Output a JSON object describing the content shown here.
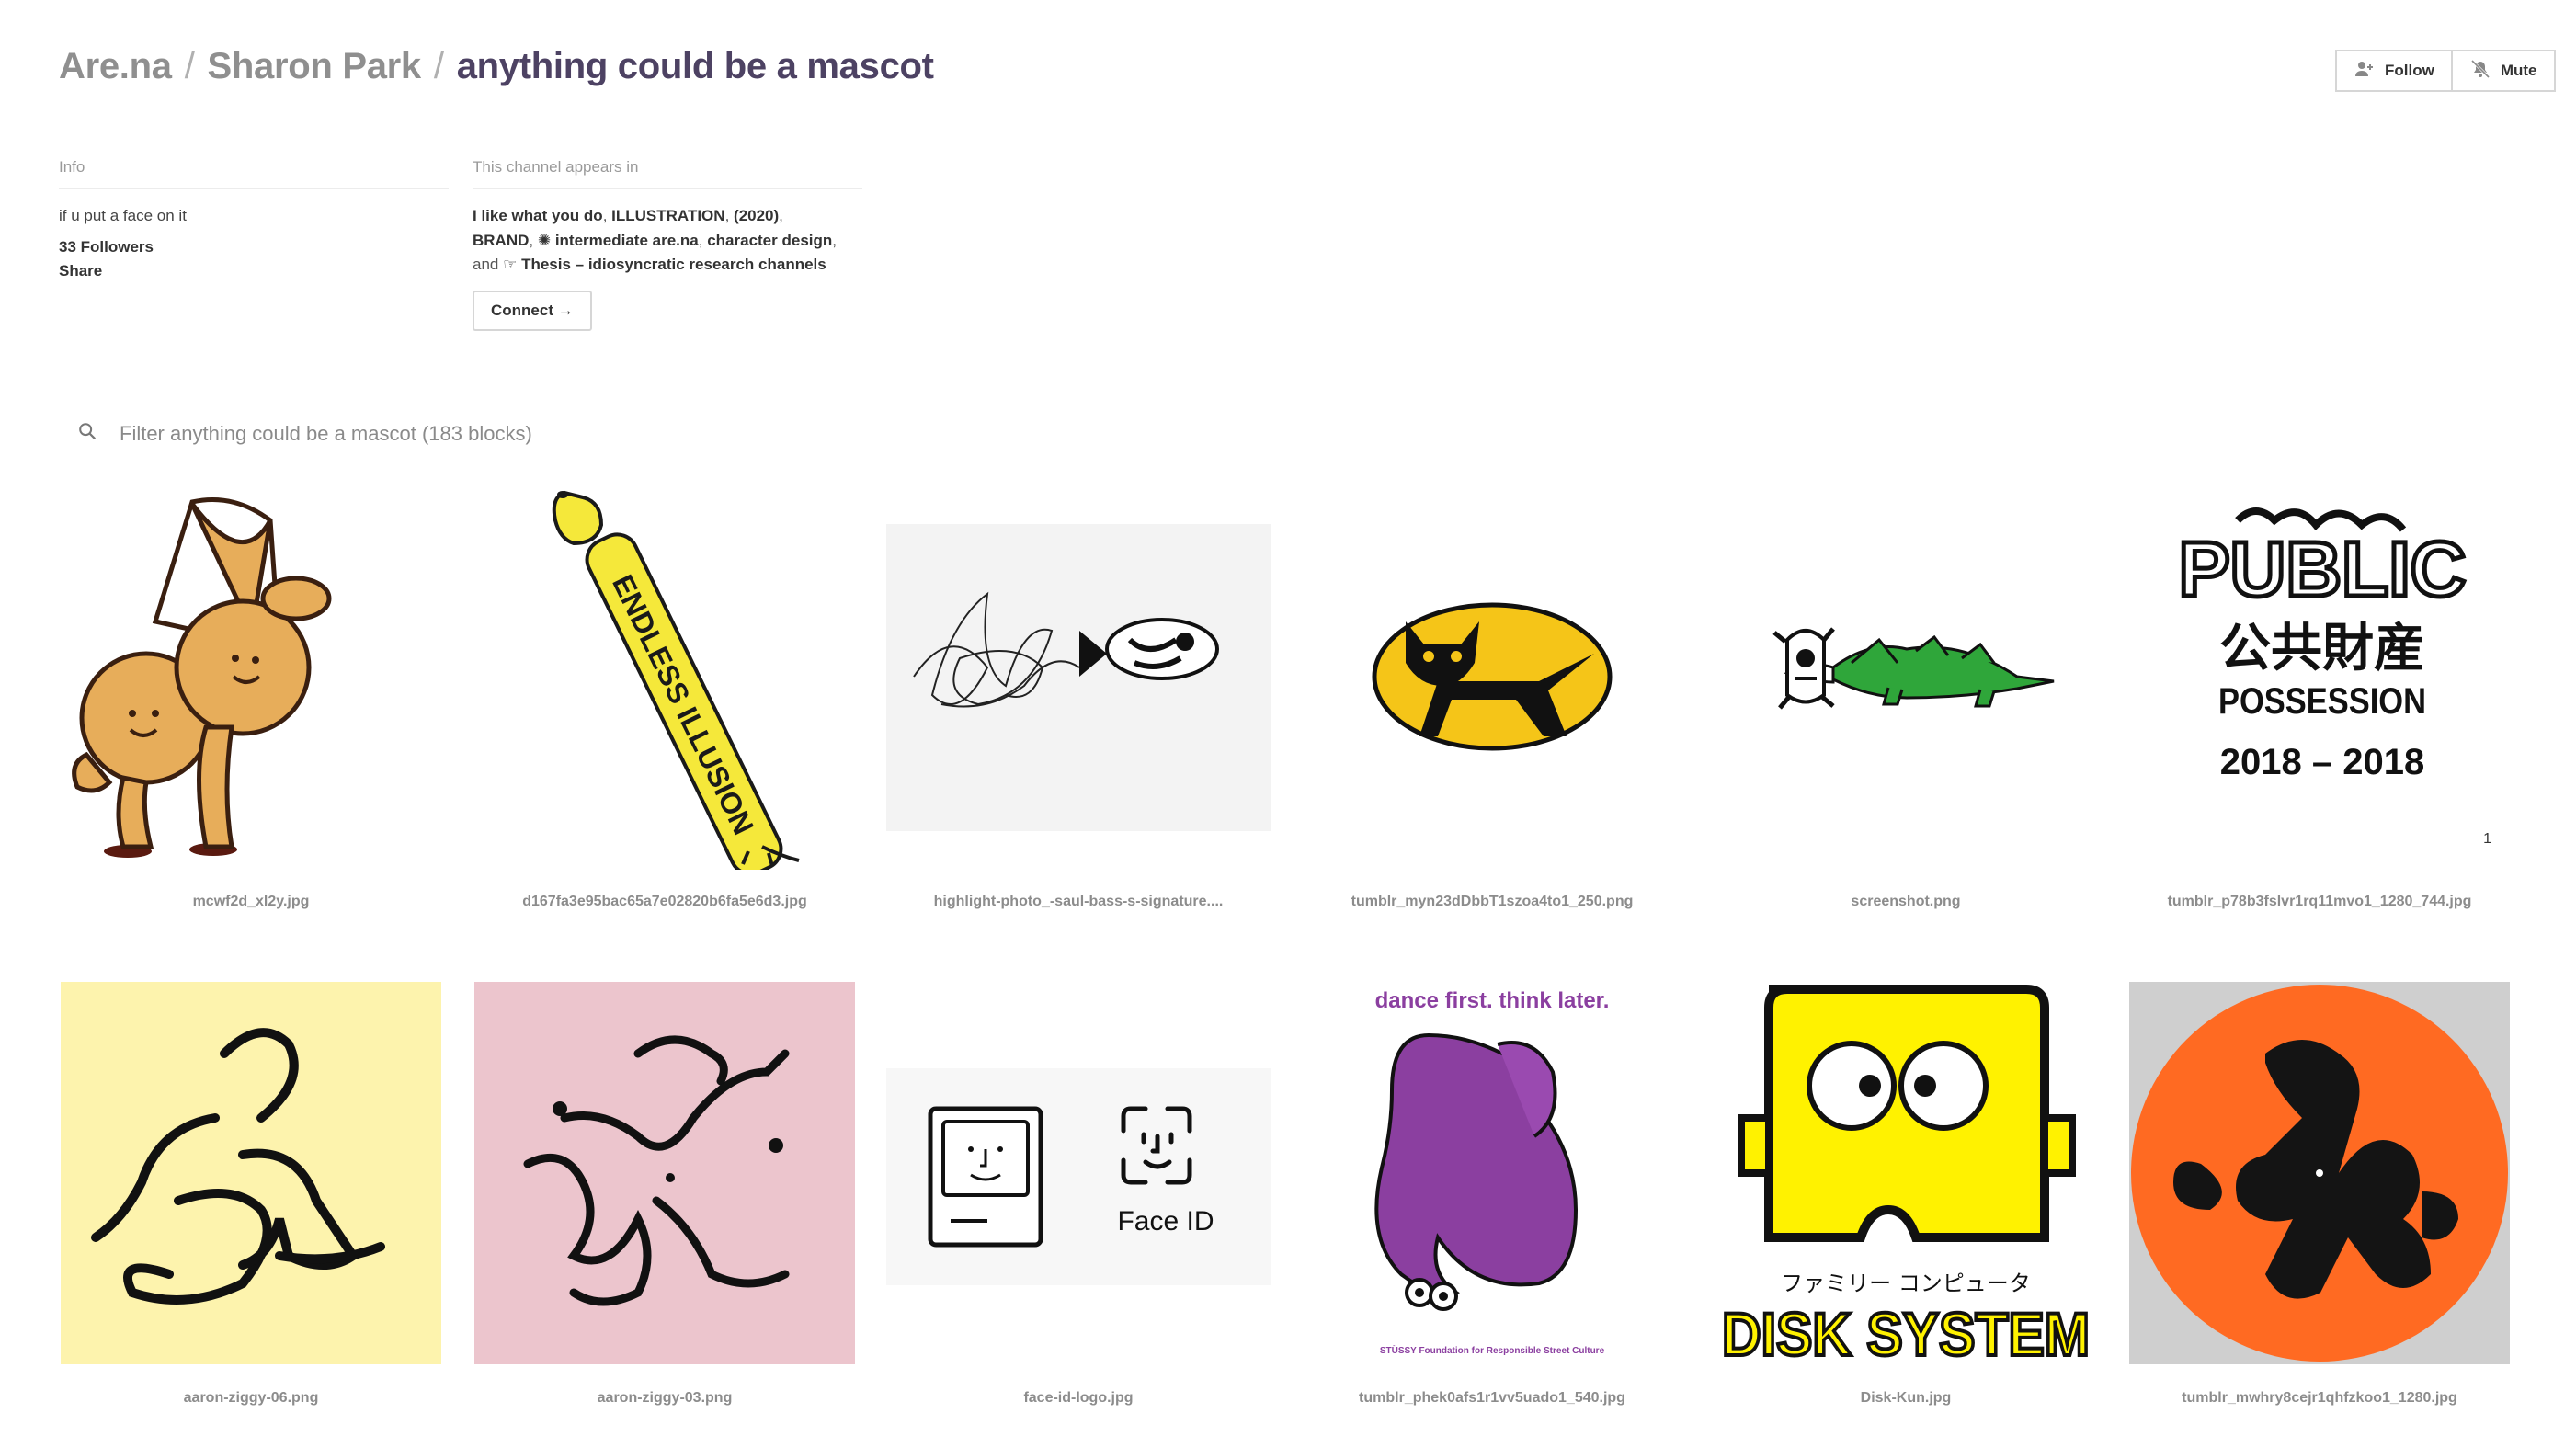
{
  "breadcrumb": {
    "root": "Are.na",
    "user": "Sharon Park",
    "channel": "anything could be a mascot",
    "separator": "/"
  },
  "actions": {
    "follow_label": "Follow",
    "mute_label": "Mute"
  },
  "info": {
    "heading": "Info",
    "description": "if u put a face on it",
    "followers": "33 Followers",
    "share": "Share"
  },
  "appears_in": {
    "heading": "This channel appears in",
    "channels": [
      "I like what you do",
      "ILLUSTRATION",
      "(2020)",
      "BRAND",
      "✺ intermediate are.na",
      "character design",
      "☞ Thesis – idiosyncratic research channels"
    ],
    "sep_comma": ",",
    "sep_and": "and",
    "connect_label": "Connect →"
  },
  "search": {
    "placeholder": "Filter anything could be a mascot (183 blocks)"
  },
  "blocks": [
    {
      "caption": "mcwf2d_xl2y.jpg",
      "icon": "music-note-mascot"
    },
    {
      "caption": "d167fa3e95bac65a7e02820b6fa5e6d3.jpg",
      "icon": "endless-illusion-dachshund",
      "text": "ENDLESS ILLUSION"
    },
    {
      "caption": "highlight-photo_-saul-bass-s-signature....",
      "icon": "signature-fish"
    },
    {
      "caption": "tumblr_myn23dDbbT1szoa4to1_250.png",
      "icon": "yamato-cat-logo"
    },
    {
      "caption": "screenshot.png",
      "icon": "crocodile-eating-person"
    },
    {
      "caption": "tumblr_p78b3fslvr1rq11mvo1_1280_744.jpg",
      "icon": "public-possession-logo",
      "lines": [
        "PUBLIC",
        "公共財産",
        "POSSESSION",
        "2018 – 2018"
      ],
      "count": "1"
    },
    {
      "caption": "aaron-ziggy-06.png",
      "icon": "ziggy-figure-yellow",
      "bg": "#fdf3ad"
    },
    {
      "caption": "aaron-ziggy-03.png",
      "icon": "ziggy-figure-pink",
      "bg": "#ecc5cd"
    },
    {
      "caption": "face-id-logo.jpg",
      "icon": "face-id-logo",
      "text": "Face ID"
    },
    {
      "caption": "tumblr_phek0afs1r1vv5uado1_540.jpg",
      "icon": "purple-elephant",
      "text": "dance first. think later.",
      "small": "STÜSSY Foundation for Responsible Street Culture"
    },
    {
      "caption": "Disk-Kun.jpg",
      "icon": "disk-kun",
      "jp": "ファミリー コンピュータ",
      "text": "DISK SYSTEM"
    },
    {
      "caption": "tumblr_mwhry8cejr1qhfzkoo1_1280.jpg",
      "icon": "orange-record-mascot",
      "bg": "#ff6a22"
    }
  ],
  "colors": {
    "title": "#4d4263",
    "crumb": "#8f8f8f",
    "yamato_yellow": "#f5c518",
    "elephant_purple": "#8b3fa0",
    "disk_yellow": "#fff200"
  }
}
